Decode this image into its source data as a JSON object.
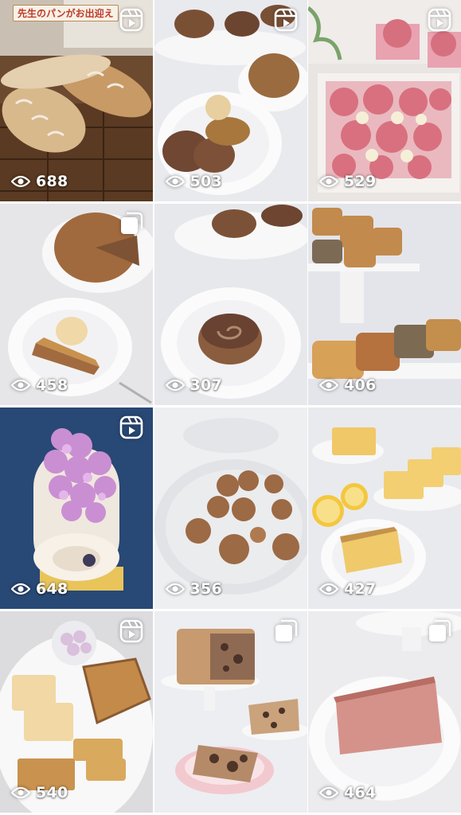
{
  "tiles": [
    {
      "views": "688",
      "badge": "reel",
      "caption": "先生のパンがお出迎え"
    },
    {
      "views": "503",
      "badge": "reel"
    },
    {
      "views": "529",
      "badge": "reel"
    },
    {
      "views": "458",
      "badge": "carousel"
    },
    {
      "views": "307",
      "badge": "none"
    },
    {
      "views": "406",
      "badge": "none"
    },
    {
      "views": "648",
      "badge": "reel"
    },
    {
      "views": "356",
      "badge": "none"
    },
    {
      "views": "427",
      "badge": "none"
    },
    {
      "views": "540",
      "badge": "reel"
    },
    {
      "views": "464",
      "badge": "carousel"
    },
    {
      "views": "464",
      "badge": "carousel"
    }
  ],
  "colors": {
    "overlay_text": "#ffffff",
    "caption_text": "#c0392b",
    "background": "#ffffff"
  },
  "icons": {
    "views": "eye-icon",
    "reel": "reel-icon",
    "carousel": "carousel-icon"
  }
}
